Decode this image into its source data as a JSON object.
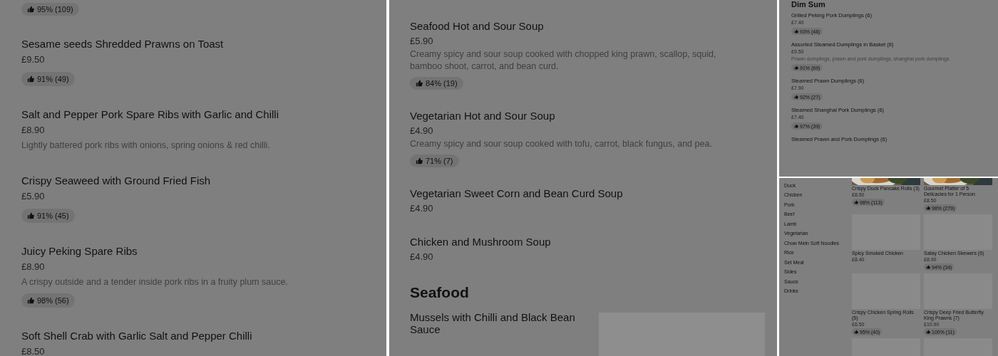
{
  "left_column": {
    "items": [
      {
        "rating": "95% (109)"
      },
      {
        "name": "Sesame seeds Shredded Prawns on Toast",
        "price": "£9.50",
        "rating": "91% (49)"
      },
      {
        "name": "Salt and Pepper Pork Spare Ribs with Garlic and Chilli",
        "price": "£8.90",
        "description": "Lightly battered pork ribs with onions, spring onions & red chilli."
      },
      {
        "name": "Crispy Seaweed with Ground Fried Fish",
        "price": "£5.90",
        "rating": "91% (45)"
      },
      {
        "name": "Juicy Peking Spare Ribs",
        "price": "£8.90",
        "description": "A crispy outside and a tender inside pork ribs in a fruity plum sauce.",
        "rating": "98% (56)"
      },
      {
        "name": "Soft Shell Crab with Garlic Salt and Pepper Chilli",
        "price": "£8.50"
      }
    ]
  },
  "middle_column": {
    "items": [
      {
        "name": "Seafood Hot and Sour Soup",
        "price": "£5.90",
        "description": "Creamy spicy and sour soup cooked with chopped king prawn, scallop, squid, bamboo shoot, carrot, and bean curd.",
        "rating": "84% (19)"
      },
      {
        "name": "Vegetarian Hot and Sour Soup",
        "price": "£4.90",
        "description": "Creamy spicy and sour soup cooked with tofu, carrot, black fungus, and pea.",
        "rating": "71% (7)"
      },
      {
        "name": "Vegetarian Sweet Corn and Bean Curd Soup",
        "price": "£4.90"
      },
      {
        "name": "Chicken and Mushroom Soup",
        "price": "£4.90"
      }
    ],
    "sections": [
      {
        "title": "Seafood",
        "items": [
          {
            "name": "Mussels with Chilli and Black Bean Sauce",
            "has_image": true
          }
        ]
      }
    ]
  },
  "dim_sum_panel": {
    "heading": "Dim Sum",
    "items": [
      {
        "name": "Grilled Peking Pork Dumplings (6)",
        "price": "£7.40",
        "rating": "93% (48)"
      },
      {
        "name": "Assorted Steamed Dumplings in Basket (8)",
        "price": "£9.50",
        "description": "Prawn dumplings, prawn and pork dumplings, shanghai pork dumplings",
        "rating": "91% (69)"
      },
      {
        "name": "Steamed Prawn Dumplings (6)",
        "price": "£7.90",
        "rating": "92% (27)"
      },
      {
        "name": "Steamed Shanghai Pork Dumplings (6)",
        "price": "£7.40",
        "rating": "97% (39)"
      },
      {
        "name": "Steamed Prawn and Pork Dumplings (6)"
      }
    ]
  },
  "category_panel": {
    "categories": [
      "Duck",
      "Chicken",
      "Pork",
      "Beef",
      "Lamb",
      "Vegetarian",
      "Chow Mein Soft Noodles",
      "Rice",
      "Set Meal",
      "Sides",
      "Sauce",
      "Drinks"
    ],
    "cards": [
      {
        "kind": "picture",
        "name": "Crispy Duck Pancake Rolls (3)",
        "price": "£8.50",
        "rating": "98% (113)"
      },
      {
        "kind": "picture",
        "name": "Gourmet Platter of 5 Delicacies for 1 Person",
        "price": "£8.50",
        "rating": "98% (279)"
      },
      {
        "kind": "placeholder",
        "name": "Spicy Smoked Chicken",
        "price": "£8.40"
      },
      {
        "kind": "placeholder",
        "name": "Satay Chicken Skewers (6)",
        "price": "£8.90",
        "rating": "94% (34)"
      },
      {
        "kind": "placeholder",
        "name": "Crispy Chicken Spring Rolls (5)",
        "price": "£6.50",
        "rating": "95% (40)"
      },
      {
        "kind": "placeholder",
        "name": "Crispy Deep Fried Butterfly King Prawns (7)",
        "price": "£10.90",
        "rating": "100% (11)"
      },
      {
        "kind": "placeholder"
      },
      {
        "kind": "placeholder"
      }
    ]
  }
}
